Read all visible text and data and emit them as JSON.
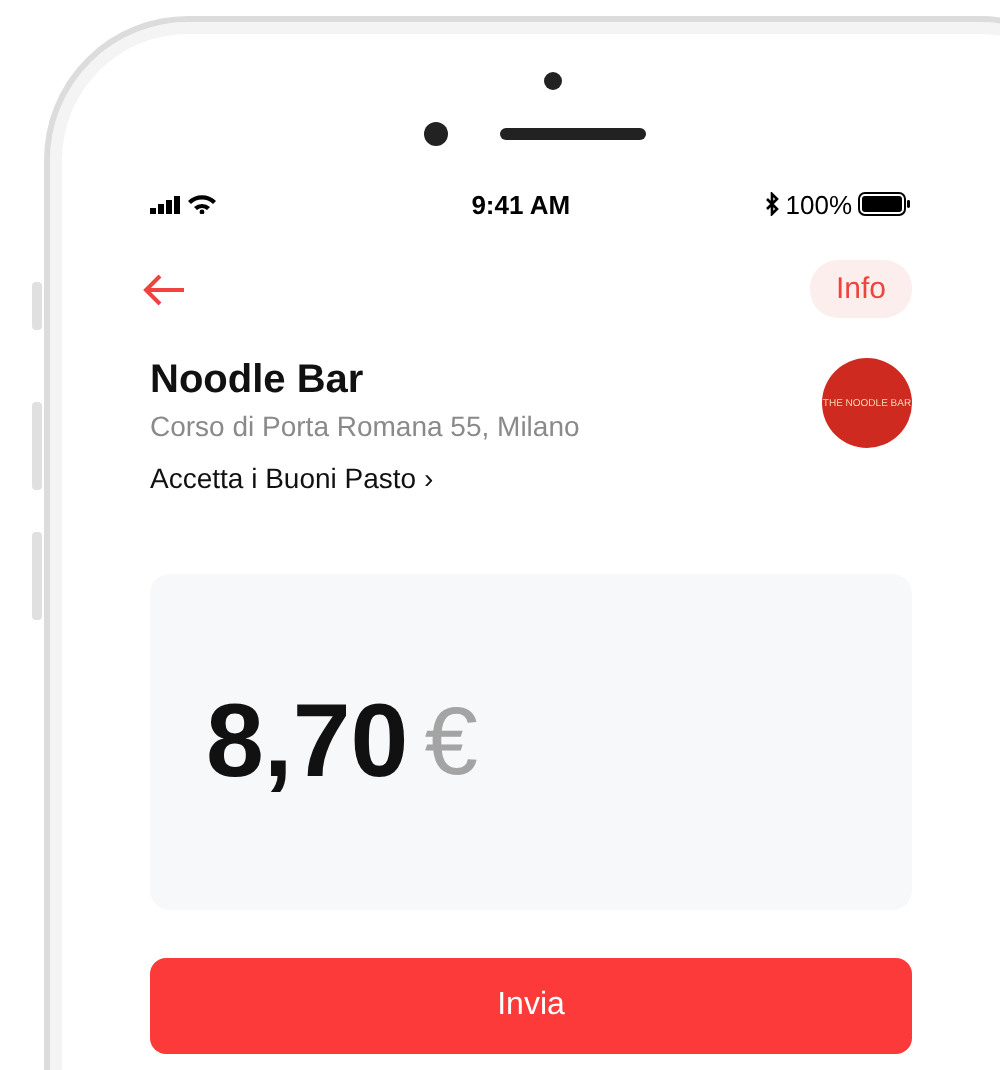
{
  "status_bar": {
    "time": "9:41 AM",
    "battery": "100%"
  },
  "nav": {
    "info_button": "Info"
  },
  "venue": {
    "name": "Noodle Bar",
    "address": "Corso di Porta Romana 55, Milano",
    "link": "Accetta i Buoni Pasto ›",
    "logo_text": "THE NOODLE BAR"
  },
  "amount": {
    "value": "8,70",
    "currency": "€"
  },
  "submit_button": "Invia"
}
